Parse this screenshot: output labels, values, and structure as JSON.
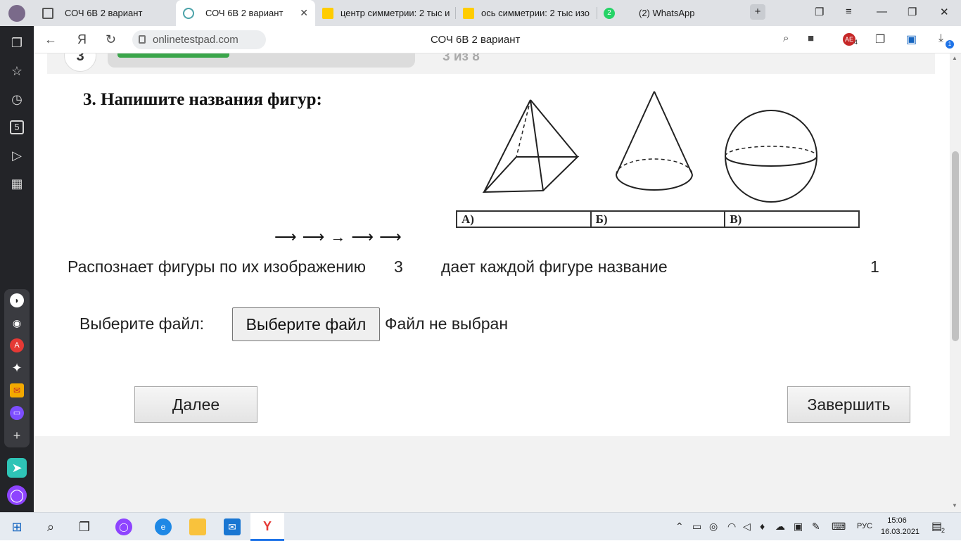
{
  "browser": {
    "tabs": [
      {
        "title": "СОЧ 6В 2 вариант",
        "active": false,
        "icon": "page-icon"
      },
      {
        "title": "СОЧ 6В 2 вариант",
        "active": true,
        "icon": "onlinetestpad-icon"
      },
      {
        "title": "центр симметрии: 2 тыс и",
        "active": false,
        "icon": "yandex-images-icon"
      },
      {
        "title": "ось симметрии: 2 тыс изо",
        "active": false,
        "icon": "yandex-images-icon"
      },
      {
        "title": "(2) WhatsApp",
        "active": false,
        "icon": "whatsapp-icon"
      }
    ],
    "whatsapp_badge": "2",
    "close_tab_glyph": "✕",
    "new_tab_glyph": "+",
    "url": "onlinetestpad.com",
    "page_title": "СОЧ 6В 2 вариант",
    "back_glyph": "←",
    "yandex_glyph": "Я",
    "reload_glyph": "↻",
    "extension_badge": "4",
    "download_badge": "1",
    "accent": "#3aa54a"
  },
  "test": {
    "question_number": "3",
    "progress_text": "3 из 8",
    "progress_fraction": 0.375,
    "heading": "3. Напишите названия фигур:",
    "answer_cells": [
      "А)",
      "Б)",
      "В)"
    ],
    "arrows": "⟶ ⟶ → ⟶ ⟶",
    "criterion_1_text": "Распознает фигуры по их изображению",
    "criterion_1_points": "3",
    "criterion_2_text": "дает каждой фигуре название",
    "criterion_2_points": "1",
    "file_label": "Выберите файл:",
    "file_button": "Выберите файл",
    "file_status": "Файл не выбран",
    "next_button": "Далее",
    "finish_button": "Завершить"
  },
  "taskbar": {
    "language": "РУС",
    "time": "15:06",
    "date": "16.03.2021",
    "notification_count": "2"
  }
}
